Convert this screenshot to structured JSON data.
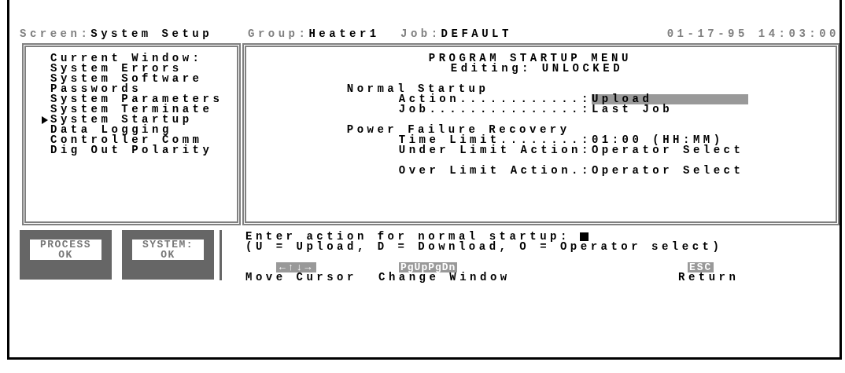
{
  "header": {
    "screen_label": "Screen:",
    "screen": "System Setup",
    "group_label": "Group:",
    "group": "Heater1",
    "job_label": "Job:",
    "job": "DEFAULT",
    "datetime": "01-17-95 14:03:00"
  },
  "sidebar": {
    "heading": "Current Window:",
    "items": [
      {
        "label": "System Errors",
        "selected": false
      },
      {
        "label": "System Software",
        "selected": false
      },
      {
        "label": "Passwords",
        "selected": false
      },
      {
        "label": "System Parameters",
        "selected": false
      },
      {
        "label": "System Terminate",
        "selected": false
      },
      {
        "label": "System Startup",
        "selected": true
      },
      {
        "label": "Data Logging",
        "selected": false
      },
      {
        "label": "Controller Comm",
        "selected": false
      },
      {
        "label": "Dig Out Polarity",
        "selected": false
      }
    ]
  },
  "main": {
    "title": "PROGRAM STARTUP MENU",
    "editing": "Editing: UNLOCKED",
    "sections": [
      {
        "heading": "Normal Startup",
        "groups": [
          {
            "fields": [
              {
                "label": "Action............:",
                "value": "Upload",
                "selected": true
              },
              {
                "label": "Job...............:",
                "value": "Last Job",
                "selected": false
              }
            ]
          }
        ]
      },
      {
        "heading": "Power Failure Recovery",
        "groups": [
          {
            "fields": [
              {
                "label": "Time Limit........:",
                "value": "01:00 (HH:MM)",
                "selected": false
              },
              {
                "label": "Under Limit Action:",
                "value": "Operator Select",
                "selected": false
              }
            ]
          },
          {
            "fields": [
              {
                "label": "Over Limit Action.:",
                "value": "Operator Select",
                "selected": false
              }
            ]
          }
        ]
      }
    ]
  },
  "status": [
    {
      "label": "PROCESS",
      "value": "OK"
    },
    {
      "label": "SYSTEM:",
      "value": "OK"
    }
  ],
  "prompt": {
    "line_1": "Enter action for normal startup:",
    "line_2": "(U = Upload, D = Download, O = Operator select)"
  },
  "keys": [
    {
      "key": "←↑↓→",
      "action": "Move Cursor"
    },
    {
      "key": "PgUpPgDn",
      "action": "Change Window"
    },
    {
      "key": "ESC",
      "action": "Return"
    }
  ]
}
